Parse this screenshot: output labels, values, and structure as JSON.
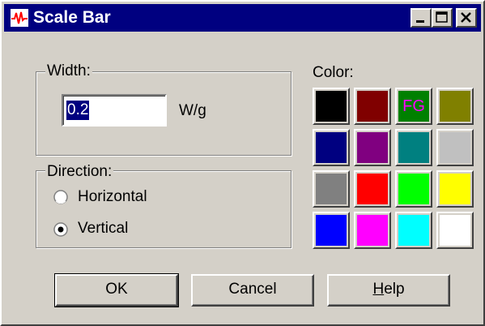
{
  "window": {
    "title": "Scale Bar",
    "icon": "waveform-icon"
  },
  "width_group": {
    "legend": "Width:",
    "value": "0.2",
    "unit": "W/g"
  },
  "direction_group": {
    "legend": "Direction:",
    "options": [
      {
        "label": "Horizontal",
        "selected": false
      },
      {
        "label": "Vertical",
        "selected": true
      }
    ]
  },
  "color": {
    "label": "Color:",
    "swatches": [
      {
        "color": "#000000",
        "text": ""
      },
      {
        "color": "#800000",
        "text": ""
      },
      {
        "color": "#008000",
        "text": "FG",
        "text_color": "#ff00ff"
      },
      {
        "color": "#808000",
        "text": ""
      },
      {
        "color": "#000080",
        "text": ""
      },
      {
        "color": "#800080",
        "text": ""
      },
      {
        "color": "#008080",
        "text": ""
      },
      {
        "color": "#c0c0c0",
        "text": ""
      },
      {
        "color": "#808080",
        "text": ""
      },
      {
        "color": "#ff0000",
        "text": ""
      },
      {
        "color": "#00ff00",
        "text": ""
      },
      {
        "color": "#ffff00",
        "text": ""
      },
      {
        "color": "#0000ff",
        "text": ""
      },
      {
        "color": "#ff00ff",
        "text": ""
      },
      {
        "color": "#00ffff",
        "text": ""
      },
      {
        "color": "#ffffff",
        "text": ""
      }
    ]
  },
  "buttons": {
    "ok": "OK",
    "cancel": "Cancel",
    "help_first": "H",
    "help_rest": "elp"
  }
}
